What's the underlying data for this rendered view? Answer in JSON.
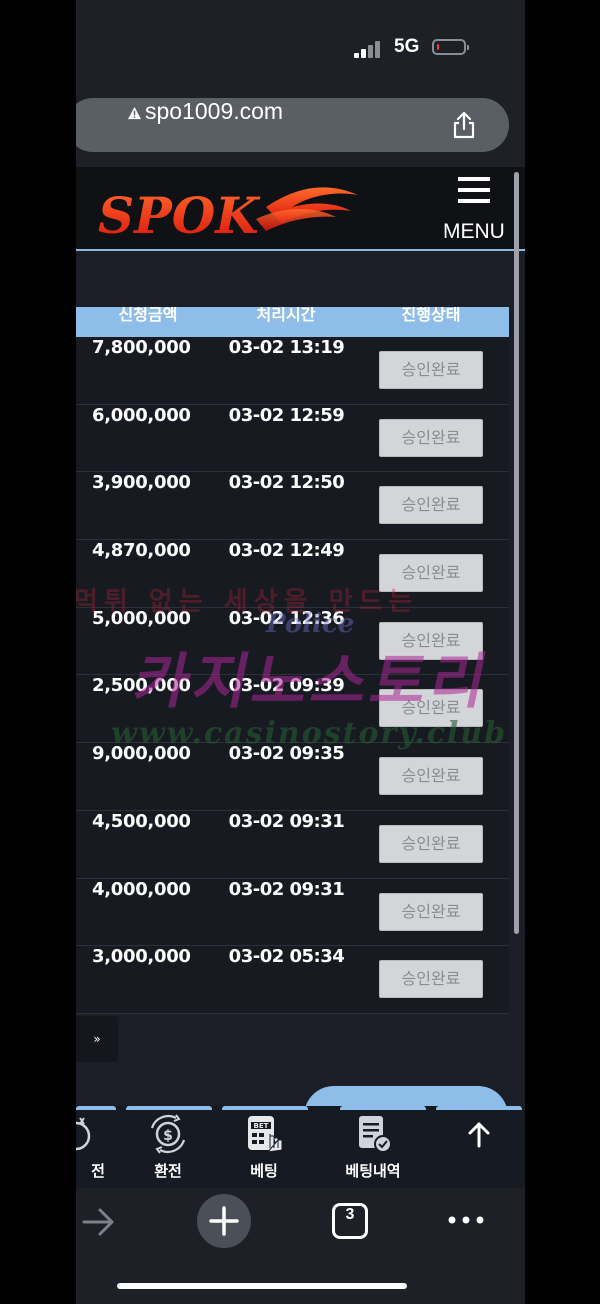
{
  "status": {
    "network": "5G"
  },
  "browser": {
    "url": "spo1009.com",
    "tab_count": "3"
  },
  "site": {
    "logo_text": "SPOK",
    "menu_label": "MENU"
  },
  "table": {
    "headers": [
      "신청금액",
      "처리시간",
      "진행상태"
    ],
    "rows": [
      {
        "amount": "7,800,000",
        "time": "03-02 13:19",
        "status": "승인완료"
      },
      {
        "amount": "6,000,000",
        "time": "03-02 12:59",
        "status": "승인완료"
      },
      {
        "amount": "3,900,000",
        "time": "03-02 12:50",
        "status": "승인완료"
      },
      {
        "amount": "4,870,000",
        "time": "03-02 12:49",
        "status": "승인완료"
      },
      {
        "amount": "5,000,000",
        "time": "03-02 12:36",
        "status": "승인완료"
      },
      {
        "amount": "2,500,000",
        "time": "03-02 09:39",
        "status": "승인완료"
      },
      {
        "amount": "9,000,000",
        "time": "03-02 09:35",
        "status": "승인완료"
      },
      {
        "amount": "4,500,000",
        "time": "03-02 09:31",
        "status": "승인완료"
      },
      {
        "amount": "4,000,000",
        "time": "03-02 09:31",
        "status": "승인완료"
      },
      {
        "amount": "3,000,000",
        "time": "03-02 05:34",
        "status": "승인완료"
      }
    ]
  },
  "pager": {
    "next_label": "»"
  },
  "watermark": {
    "line1": "먹튀 없는 세상을 만드는",
    "line2": "카지노스토리",
    "line3": "www.casinostory.club",
    "police": "Police"
  },
  "bottom_nav": [
    {
      "label": "전",
      "icon": "deposit-icon"
    },
    {
      "label": "환전",
      "icon": "exchange-icon"
    },
    {
      "label": "베팅",
      "icon": "bet-icon"
    },
    {
      "label": "베팅내역",
      "icon": "bet-history-icon"
    },
    {
      "label": "",
      "icon": "arrow-up-icon"
    }
  ],
  "colors": {
    "accent": "#8fbde9",
    "background": "#1b1e26",
    "logo_red": "#e8231a"
  }
}
